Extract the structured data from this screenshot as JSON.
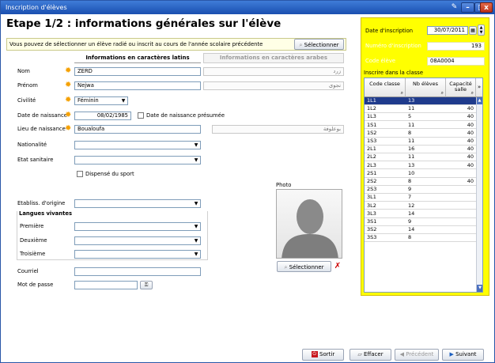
{
  "window": {
    "title": "Inscription d'élèves",
    "controls": [
      "pin-icon",
      "minimize",
      "maximize",
      "close"
    ]
  },
  "header": {
    "title": "Etape 1/2 : informations générales sur l'élève"
  },
  "info_bar": {
    "text": "Vous pouvez de sélectionner un élève radié ou inscrit au cours de l'année scolaire précédente",
    "button_label": "Sélectionner"
  },
  "columns": {
    "latin": "Informations en caractères latins",
    "arabic": "Informations en caractères arabes"
  },
  "form": {
    "nom": {
      "label": "Nom",
      "value": "ZERD",
      "arabic": "زرد"
    },
    "prenom": {
      "label": "Prénom",
      "value": "Nejwa",
      "arabic": "نجوى"
    },
    "civilite": {
      "label": "Civilité",
      "value": "Féminin"
    },
    "date_naissance": {
      "label": "Date de naissance",
      "value": "08/02/1985",
      "presumee_label": "Date de naissance présumée",
      "presumee_checked": false
    },
    "lieu_naissance": {
      "label": "Lieu de naissance",
      "value": "Boualoufa",
      "arabic": "بوعلوفة"
    },
    "nationalite": {
      "label": "Nationalité",
      "value": ""
    },
    "etat_sanitaire": {
      "label": "Etat sanitaire",
      "value": ""
    },
    "dispense_sport": {
      "label": "Dispensé du sport",
      "checked": false
    },
    "etablissement": {
      "label": "Etabliss. d'origine",
      "value": ""
    },
    "langues": {
      "title": "Langues vivantes",
      "premiere": {
        "label": "Première",
        "value": ""
      },
      "deuxieme": {
        "label": "Deuxième",
        "value": ""
      },
      "troisieme": {
        "label": "Troisième",
        "value": ""
      }
    },
    "courriel": {
      "label": "Courriel",
      "value": ""
    },
    "mot_de_passe": {
      "label": "Mot de passe",
      "value": ""
    }
  },
  "photo": {
    "label": "Photo",
    "select_label": "Sélectionner"
  },
  "side_panel": {
    "date_inscription_label": "Date d'inscription",
    "date_inscription": "30/07/2011",
    "numero_label": "Numéro d'inscription",
    "numero": "193",
    "code_label": "Code élève",
    "code": "08A0004",
    "class_label": "Inscrire dans la classe",
    "table": {
      "headers": [
        "Code classe",
        "Nb élèves",
        "Capacité salle"
      ],
      "rows": [
        [
          "1L1",
          "13",
          ""
        ],
        [
          "1L2",
          "11",
          "40"
        ],
        [
          "1L3",
          "5",
          "40"
        ],
        [
          "1S1",
          "11",
          "40"
        ],
        [
          "1S2",
          "8",
          "40"
        ],
        [
          "1S3",
          "11",
          "40"
        ],
        [
          "2L1",
          "16",
          "40"
        ],
        [
          "2L2",
          "11",
          "40"
        ],
        [
          "2L3",
          "13",
          "40"
        ],
        [
          "2S1",
          "10",
          ""
        ],
        [
          "2S2",
          "8",
          "40"
        ],
        [
          "2S3",
          "9",
          ""
        ],
        [
          "3L1",
          "7",
          ""
        ],
        [
          "3L2",
          "12",
          ""
        ],
        [
          "3L3",
          "14",
          ""
        ],
        [
          "3S1",
          "9",
          ""
        ],
        [
          "3S2",
          "14",
          ""
        ],
        [
          "3S3",
          "8",
          ""
        ]
      ],
      "selected_row": 0
    }
  },
  "footer": {
    "sortir": "Sortir",
    "effacer": "Effacer",
    "precedent": "Précédent",
    "suivant": "Suivant"
  },
  "colors": {
    "title_bar": "#1a4fb0",
    "side_panel": "#ffff00",
    "selected_row": "#1f3b8c",
    "required_star": "#f5a000",
    "info_bar": "#ffffe6"
  }
}
